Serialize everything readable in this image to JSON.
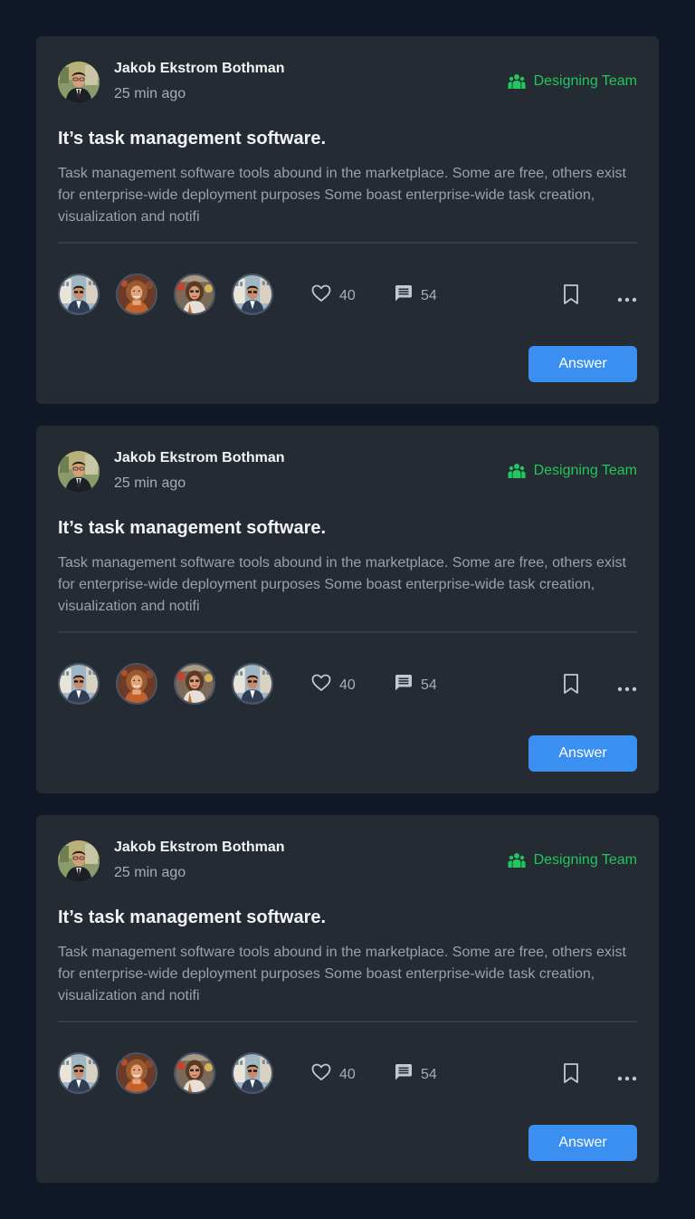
{
  "colors": {
    "page_background": "#111827",
    "card_background": "#242b33",
    "team_accent": "#22c55e",
    "button_primary": "#3b8ff0"
  },
  "posts": [
    {
      "author": "Jakob Ekstrom Bothman",
      "time": "25 min ago",
      "team": "Designing Team",
      "team_icon": "users-group-icon",
      "title": "It’s task management software.",
      "body": "Task management software tools abound in the marketplace. Some are free, others exist for enterprise-wide deployment purposes Some boast enterprise-wide task creation, visualization and notifi",
      "likes": "40",
      "comments": "54",
      "answer_label": "Answer"
    },
    {
      "author": "Jakob Ekstrom Bothman",
      "time": "25 min ago",
      "team": "Designing Team",
      "team_icon": "users-group-icon",
      "title": "It’s task management software.",
      "body": "Task management software tools abound in the marketplace. Some are free, others exist for enterprise-wide deployment purposes Some boast enterprise-wide task creation, visualization and notifi",
      "likes": "40",
      "comments": "54",
      "answer_label": "Answer"
    },
    {
      "author": "Jakob Ekstrom Bothman",
      "time": "25 min ago",
      "team": "Designing Team",
      "team_icon": "users-group-icon",
      "title": "It’s task management software.",
      "body": "Task management software tools abound in the marketplace. Some are free, others exist for enterprise-wide deployment purposes Some boast enterprise-wide task creation, visualization and notifi",
      "likes": "40",
      "comments": "54",
      "answer_label": "Answer"
    }
  ]
}
